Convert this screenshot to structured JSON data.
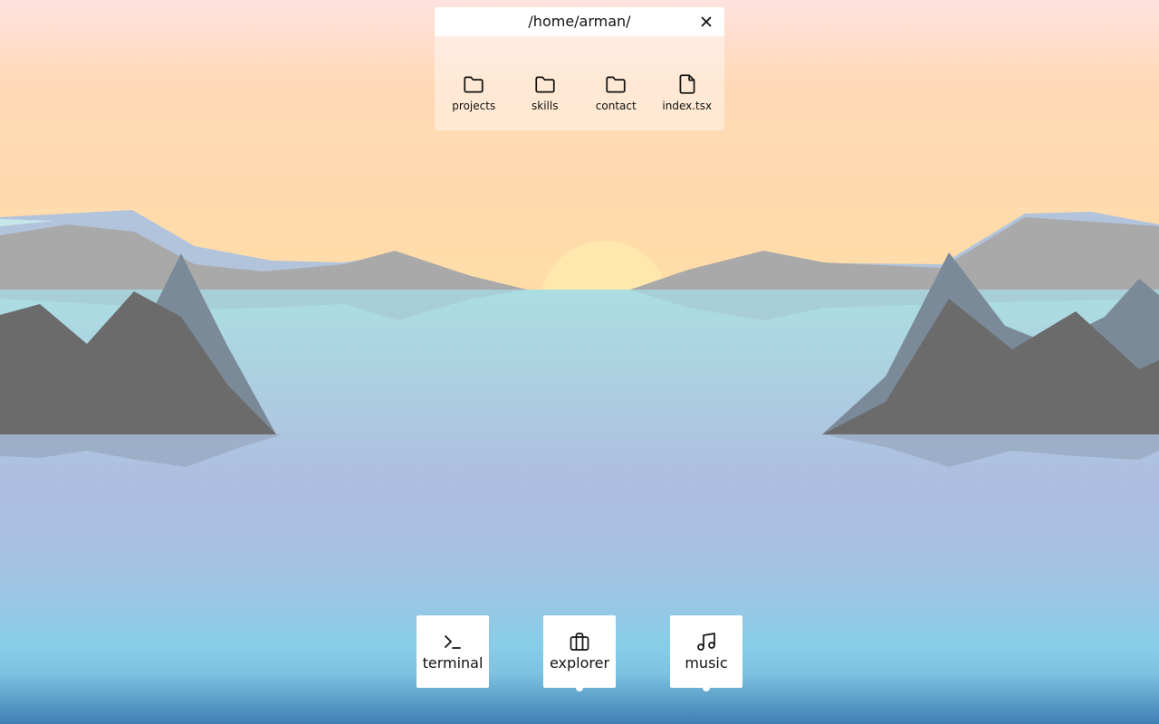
{
  "explorer_window": {
    "title": "/home/arman/",
    "close_icon": "close-icon",
    "items": [
      {
        "label": "projects",
        "icon": "folder-icon"
      },
      {
        "label": "skills",
        "icon": "folder-icon"
      },
      {
        "label": "contact",
        "icon": "folder-icon"
      },
      {
        "label": "index.tsx",
        "icon": "file-icon"
      }
    ]
  },
  "dock": {
    "items": [
      {
        "label": "terminal",
        "icon": "terminal-icon",
        "running": false
      },
      {
        "label": "explorer",
        "icon": "briefcase-icon",
        "running": true
      },
      {
        "label": "music",
        "icon": "music-note-icon",
        "running": true
      }
    ]
  },
  "colors": {
    "sky_top": "#ffe1dd",
    "sky_bottom": "#ffdfa8",
    "sun": "#ffe6ad",
    "water_top": "#aadde3",
    "water_mid": "#adbddf",
    "water_bottom": "#85cde9",
    "mountain_far": "#a8a8a8",
    "mountain_mid": "#7b8a98",
    "mountain_near": "#6b6b6b",
    "window_titlebar": "#ffffff",
    "dock_tile": "#ffffff"
  }
}
